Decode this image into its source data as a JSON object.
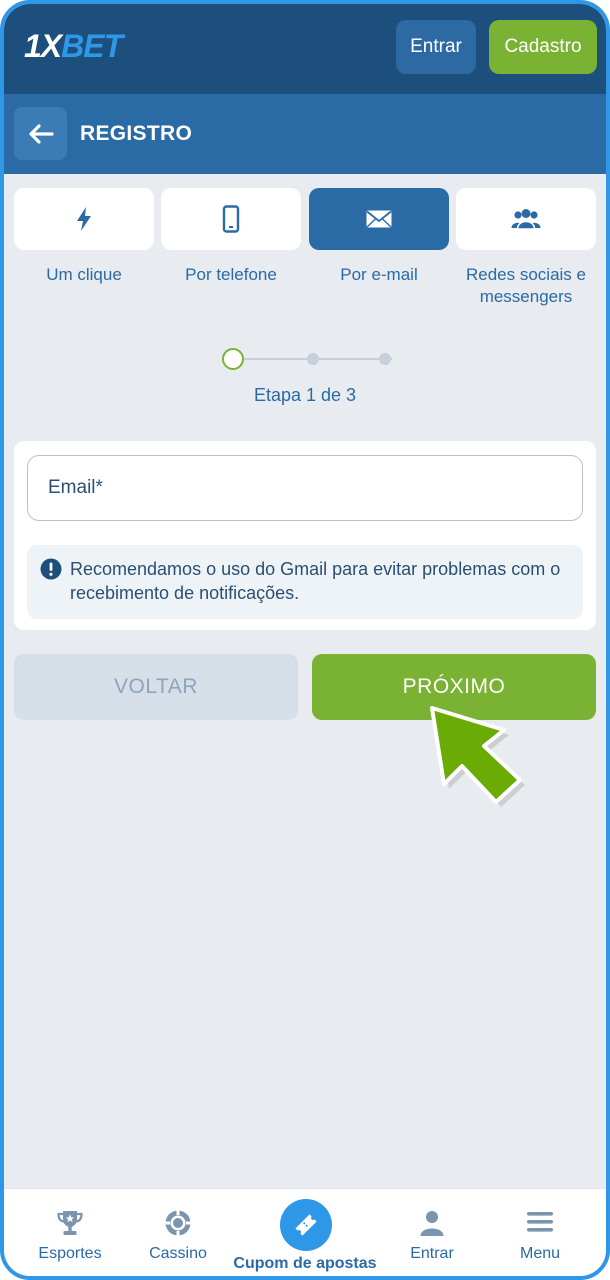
{
  "header": {
    "logo_prefix": "1X",
    "logo_suffix": "BET",
    "login_label": "Entrar",
    "register_label": "Cadastro"
  },
  "titlebar": {
    "title": "REGISTRO"
  },
  "methods": [
    {
      "label": "Um clique",
      "icon": "lightning-icon",
      "active": false
    },
    {
      "label": "Por telefone",
      "icon": "phone-icon",
      "active": false
    },
    {
      "label": "Por e-mail",
      "icon": "envelope-icon",
      "active": true
    },
    {
      "label": "Redes sociais e messengers",
      "icon": "people-icon",
      "active": false
    }
  ],
  "stepper": {
    "current": 1,
    "total": 3,
    "text": "Etapa 1 de 3"
  },
  "form": {
    "email_placeholder": "Email*",
    "notice": "Recomendamos o uso do Gmail para evitar problemas com o recebimento de notificações."
  },
  "actions": {
    "back_label": "VOLTAR",
    "next_label": "PRÓXIMO"
  },
  "bottom_nav": {
    "sports": "Esportes",
    "casino": "Cassino",
    "coupon": "Cupom de apostas",
    "login": "Entrar",
    "menu": "Menu"
  },
  "colors": {
    "header_bg": "#1d4f7c",
    "titlebar_bg": "#2a6aa5",
    "accent_green": "#7ab233",
    "accent_blue": "#2f97e8",
    "page_bg": "#e8ebef"
  }
}
